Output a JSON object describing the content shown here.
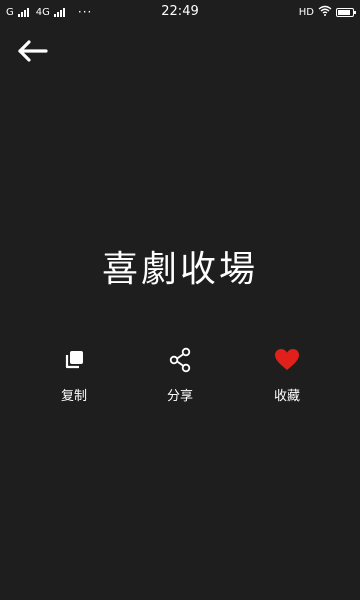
{
  "status_bar": {
    "sim1_label": "G",
    "sim2_label": "4G",
    "dots": "···",
    "time": "22:49",
    "hd_label": "HD",
    "battery_level": 0.85
  },
  "header": {
    "back_icon": "arrow-left-icon"
  },
  "main": {
    "title": "喜劇收場"
  },
  "actions": [
    {
      "label": "复制",
      "icon": "copy-icon",
      "color": "#ffffff"
    },
    {
      "label": "分享",
      "icon": "share-icon",
      "color": "#ffffff"
    },
    {
      "label": "收藏",
      "icon": "heart-icon",
      "color": "#e0201b"
    }
  ],
  "colors": {
    "background": "#1e1e1e",
    "text": "#ffffff",
    "favorite": "#e0201b"
  }
}
